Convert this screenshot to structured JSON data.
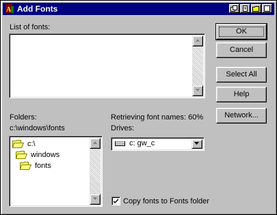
{
  "window": {
    "title": "Add Fonts"
  },
  "fonts_list": {
    "label": "List of fonts:",
    "items": []
  },
  "folders": {
    "label": "Folders:",
    "path": "c:\\windows\\fonts",
    "tree": [
      "c:\\",
      "windows",
      "fonts"
    ]
  },
  "status": {
    "text": "Retrieving font names: 60%",
    "progress_percent": 60
  },
  "drives": {
    "label": "Drives:",
    "selected": "c: gw_c"
  },
  "copy_option": {
    "label": "Copy fonts to Fonts folder",
    "checked": true
  },
  "buttons": {
    "ok": "OK",
    "cancel": "Cancel",
    "select_all": "Select All",
    "help": "Help",
    "network": "Network..."
  },
  "icons": {
    "app": "fonts-app-icon",
    "folder": "folder-icon",
    "drive": "hard-drive-icon"
  },
  "colors": {
    "titlebar": "#000080",
    "face": "#c0c0c0",
    "folder": "#ffff80"
  }
}
